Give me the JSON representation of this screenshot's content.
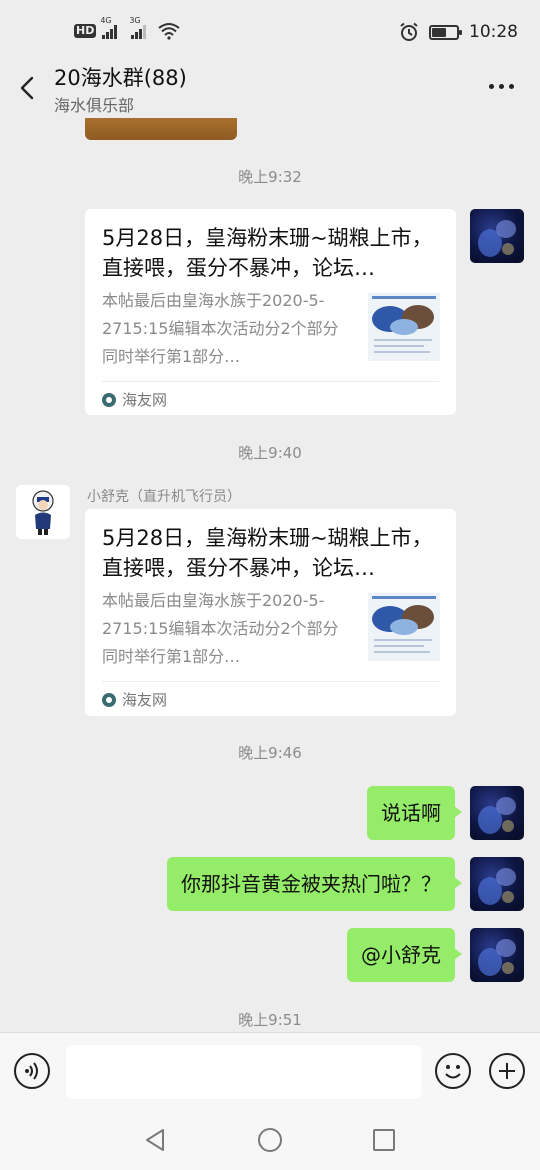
{
  "status_bar": {
    "hd_badge": "HD",
    "signal_1_label": "4G",
    "signal_2_label": "3G",
    "time": "10:28",
    "battery_level": 0.6,
    "icons": [
      "hd-icon",
      "signal-icon",
      "wifi-icon",
      "alarm-icon",
      "battery-icon"
    ]
  },
  "header": {
    "title": "20海水群(88)",
    "subtitle": "海水俱乐部"
  },
  "messages": {
    "time_1": "晚上9:32",
    "card_1": {
      "title": "5月28日，皇海粉末珊~瑚粮上市，直接喂，蛋分不暴冲，论坛…",
      "desc": "本帖最后由皇海水族于2020-5-2715:15编辑本次活动分2个部分同时举行第1部分…",
      "source": "海友网"
    },
    "time_2": "晚上9:40",
    "sender_name": "小舒克（直升机飞行员）",
    "card_2": {
      "title": "5月28日，皇海粉末珊~瑚粮上市，直接喂，蛋分不暴冲，论坛…",
      "desc": "本帖最后由皇海水族于2020-5-2715:15编辑本次活动分2个部分同时举行第1部分…",
      "source": "海友网"
    },
    "time_3": "晚上9:46",
    "bubble_1": "说话啊",
    "bubble_2": "你那抖音黄金被夹热门啦？？",
    "bubble_3": "@小舒克",
    "time_4": "晚上9:51"
  },
  "input_bar": {
    "placeholder": ""
  },
  "colors": {
    "background": "#ededed",
    "my_bubble": "#95ec69",
    "card": "#ffffff"
  }
}
